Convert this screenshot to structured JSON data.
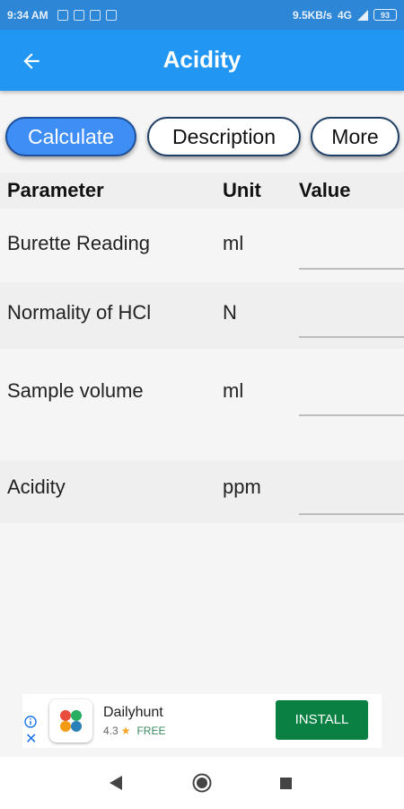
{
  "status_bar": {
    "time": "9:34 AM",
    "speed": "9.5KB/s",
    "network": "4G",
    "battery": "93"
  },
  "app_bar": {
    "title": "Acidity"
  },
  "tabs": [
    {
      "label": "Calculate",
      "active": true
    },
    {
      "label": "Description",
      "active": false
    },
    {
      "label": "More",
      "active": false
    }
  ],
  "table": {
    "headers": {
      "parameter": "Parameter",
      "unit": "Unit",
      "value": "Value"
    },
    "rows": [
      {
        "parameter": "Burette Reading",
        "unit": "ml",
        "value": ""
      },
      {
        "parameter": "Normality of HCl",
        "unit": "N",
        "value": ""
      },
      {
        "parameter": "Sample volume",
        "unit": "ml",
        "value": ""
      },
      {
        "parameter": "Acidity",
        "unit": "ppm",
        "value": ""
      }
    ]
  },
  "ad": {
    "app_name": "Dailyhunt",
    "rating": "4.3",
    "price": "FREE",
    "install_label": "INSTALL",
    "close_symbol": "✕"
  },
  "colors": {
    "primary": "#2196f3",
    "status_bar": "#2e86d6",
    "active_tab": "#3f8ef5",
    "install_button": "#0b8043"
  }
}
